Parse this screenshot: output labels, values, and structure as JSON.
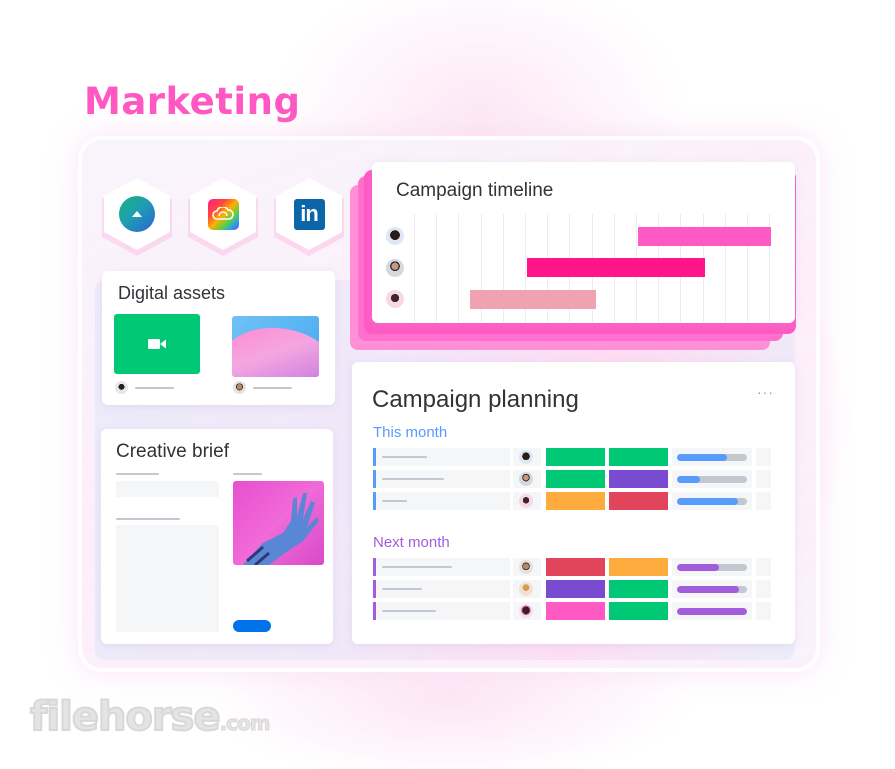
{
  "page": {
    "title": "Marketing"
  },
  "integrations": [
    {
      "name": "app-integration",
      "icon": "cloud-upload-icon"
    },
    {
      "name": "adobe-creative-cloud",
      "icon": "adobe-creative-cloud-icon"
    },
    {
      "name": "linkedin",
      "icon": "linkedin-icon",
      "glyph": "in"
    }
  ],
  "timeline": {
    "title": "Campaign timeline",
    "columns": 16,
    "rows": [
      {
        "avatar": "person-1",
        "start": 10.1,
        "end": 16.1,
        "color": "#ff5ac4"
      },
      {
        "avatar": "person-2",
        "start": 5.1,
        "end": 13.1,
        "color": "#ff158a"
      },
      {
        "avatar": "person-3",
        "start": 2.5,
        "end": 8.2,
        "color": "#f0a2b0"
      }
    ]
  },
  "digital_assets": {
    "title": "Digital assets",
    "items": [
      {
        "type": "video",
        "icon": "video-camera-icon",
        "color": "#00c875",
        "owner": "person-4"
      },
      {
        "type": "image",
        "icon": "abstract-image",
        "owner": "person-5"
      }
    ]
  },
  "creative_brief": {
    "title": "Creative brief",
    "image": "hand-image",
    "button_color": "#0073ea"
  },
  "planning": {
    "title": "Campaign planning",
    "menu_label": "···",
    "groups": [
      {
        "label": "This month",
        "color": "#579bfc",
        "rows": [
          {
            "avatar": "person-1",
            "status1": "#00c875",
            "status2": "#00c875",
            "progress": 0.71
          },
          {
            "avatar": "person-6",
            "status1": "#00c875",
            "status2": "#784bd1",
            "progress": 0.33
          },
          {
            "avatar": "person-7",
            "status1": "#fdab3d",
            "status2": "#e2445c",
            "progress": 0.87
          }
        ]
      },
      {
        "label": "Next month",
        "color": "#a25ddc",
        "rows": [
          {
            "avatar": "person-5",
            "status1": "#e2445c",
            "status2": "#fdab3d",
            "progress": 0.6
          },
          {
            "avatar": "person-8",
            "status1": "#784bd1",
            "status2": "#00c875",
            "progress": 0.89
          },
          {
            "avatar": "person-9",
            "status1": "#ff5ac4",
            "status2": "#00c875",
            "progress": 1.0
          }
        ]
      }
    ]
  },
  "watermark": {
    "text": "filehorse",
    "suffix": ".com"
  }
}
